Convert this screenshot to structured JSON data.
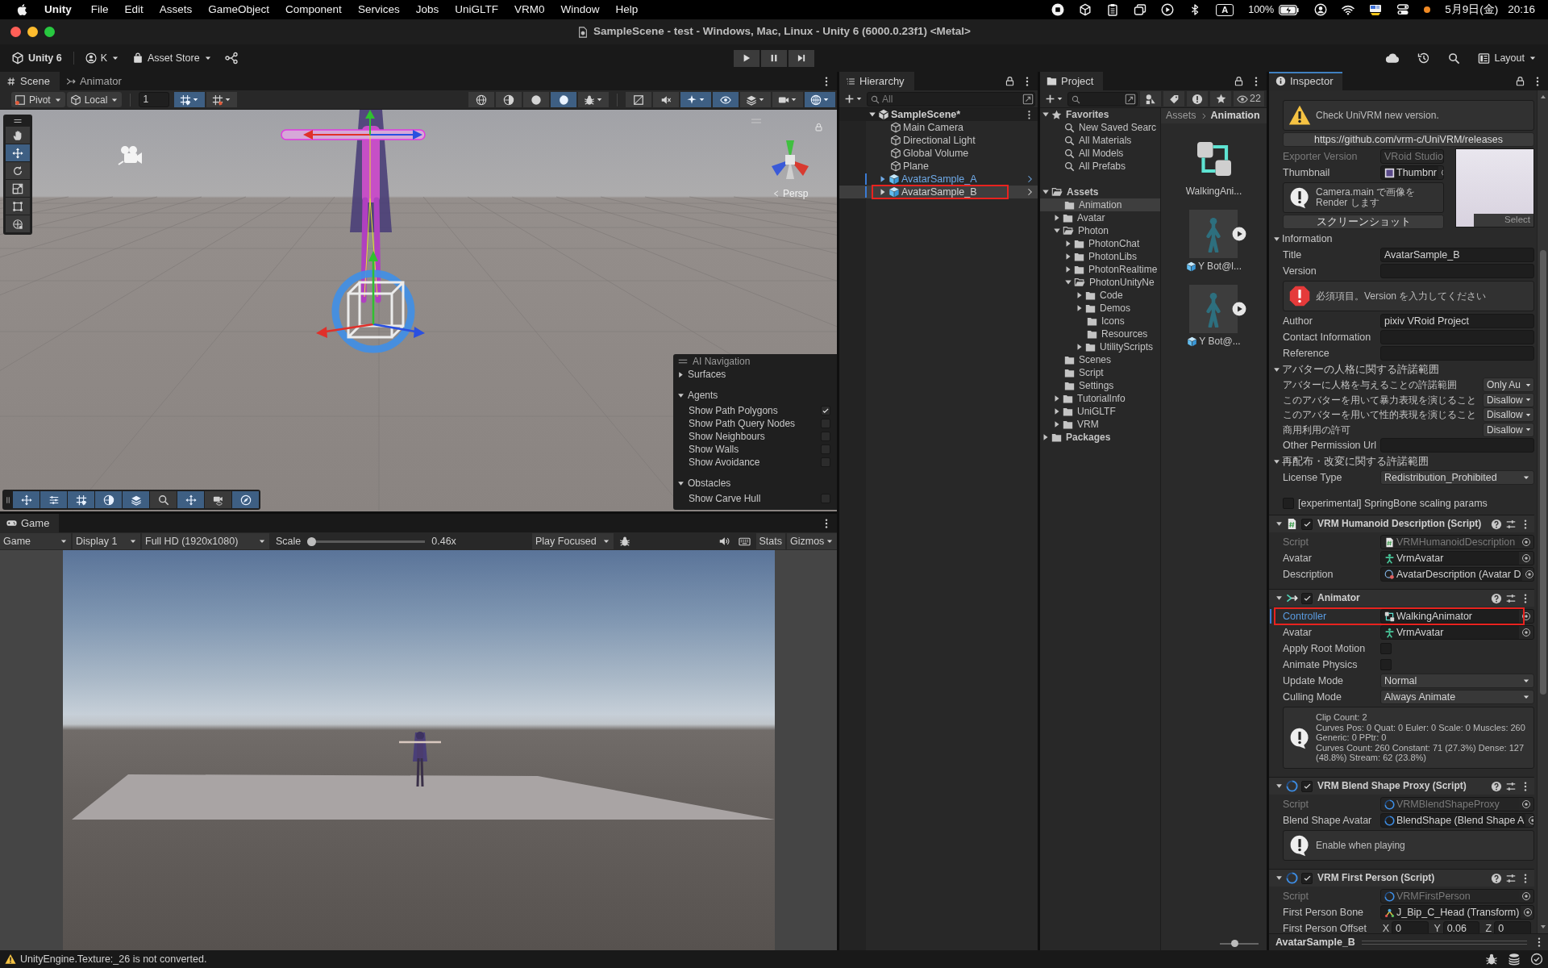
{
  "menu_bar": {
    "app": "Unity",
    "items": [
      "File",
      "Edit",
      "Assets",
      "GameObject",
      "Component",
      "Services",
      "Jobs",
      "UniGLTF",
      "VRM0",
      "Window",
      "Help"
    ],
    "input_source": "A",
    "battery": "100%",
    "date": "5月9日(金)",
    "time": "20:16"
  },
  "window": {
    "title": "SampleScene - test - Windows, Mac, Linux - Unity 6 (6000.0.23f1) <Metal>"
  },
  "toolbar": {
    "version": "Unity 6",
    "account": "K",
    "store": "Asset Store",
    "layout": "Layout"
  },
  "scene_panel": {
    "tabs": [
      {
        "label": "Scene",
        "kind": "scene",
        "selected": true
      },
      {
        "label": "Animator",
        "kind": "animator",
        "selected": false
      }
    ],
    "pivot": "Pivot",
    "space": "Local",
    "snap_increment": "1",
    "snap_buttons": [
      {
        "kind": "snap",
        "on": true
      },
      {
        "kind": "grid",
        "on": false
      }
    ],
    "view_buttons": [
      {
        "kind": "wireframe",
        "on": false
      },
      {
        "kind": "shadedwire",
        "on": false
      },
      {
        "kind": "shaded",
        "on": false
      },
      {
        "kind": "lit",
        "on": true
      },
      {
        "kind": "debug",
        "on": false
      },
      {
        "kind": "flat",
        "on": false
      },
      {
        "kind": "audio",
        "on": false
      },
      {
        "kind": "effects",
        "on": true
      },
      {
        "kind": "visibility",
        "on": true
      },
      {
        "kind": "layers",
        "on": false
      },
      {
        "kind": "camera",
        "on": false
      },
      {
        "kind": "gizmos",
        "on": true
      }
    ],
    "tools": [
      {
        "kind": "hand",
        "selected": false
      },
      {
        "kind": "move",
        "selected": true
      },
      {
        "kind": "rotate",
        "selected": false
      },
      {
        "kind": "scale",
        "selected": false
      },
      {
        "kind": "rect",
        "selected": false
      },
      {
        "kind": "transform",
        "selected": false
      }
    ],
    "camera_label": "Persp",
    "ai_navigation": {
      "title": "AI Navigation",
      "sections": [
        {
          "label": "Surfaces",
          "expanded": false
        },
        {
          "label": "Agents",
          "expanded": true,
          "options": [
            {
              "label": "Show Path Polygons",
              "checked": true
            },
            {
              "label": "Show Path Query Nodes",
              "checked": false
            },
            {
              "label": "Show Neighbours",
              "checked": false
            },
            {
              "label": "Show Walls",
              "checked": false
            },
            {
              "label": "Show Avoidance",
              "checked": false
            }
          ]
        },
        {
          "label": "Obstacles",
          "expanded": true,
          "options": [
            {
              "label": "Show Carve Hull",
              "checked": false
            }
          ]
        }
      ]
    },
    "overlay_buttons": [
      {
        "kind": "move",
        "on": true
      },
      {
        "kind": "settings",
        "on": true
      },
      {
        "kind": "grid",
        "on": true
      },
      {
        "kind": "lighting",
        "on": true
      },
      {
        "kind": "navmesh",
        "on": true
      },
      {
        "kind": "search",
        "on": false
      },
      {
        "kind": "pivot",
        "on": true
      },
      {
        "kind": "camera",
        "on": false
      },
      {
        "kind": "compass",
        "on": true
      }
    ]
  },
  "game_panel": {
    "tabs": [
      {
        "label": "Game",
        "kind": "game",
        "selected": true
      }
    ],
    "mode": "Game",
    "display": "Display 1",
    "resolution": "Full HD (1920x1080)",
    "scale_label": "Scale",
    "scale": {
      "level": 0
    },
    "scale_reading": "0.46x",
    "play_mode": "Play Focused",
    "stats": "Stats",
    "gizmos": "Gizmos"
  },
  "hierarchy": {
    "tab": "Hierarchy",
    "search_placeholder": "All",
    "items": [
      {
        "label": "SampleScene*",
        "kind": "scene",
        "expanded": true,
        "selected": false,
        "outlined": false,
        "children": [
          {
            "label": "Main Camera",
            "kind": "object",
            "selected": false,
            "outlined": false
          },
          {
            "label": "Directional Light",
            "kind": "object",
            "selected": false,
            "outlined": false
          },
          {
            "label": "Global Volume",
            "kind": "object",
            "selected": false,
            "outlined": false
          },
          {
            "label": "Plane",
            "kind": "object",
            "selected": false,
            "outlined": false
          },
          {
            "label": "AvatarSample_A",
            "kind": "prefab",
            "expanded": false,
            "selected": false,
            "outlined": false
          },
          {
            "label": "AvatarSample_B",
            "kind": "prefab",
            "expanded": false,
            "selected": true,
            "outlined": true
          }
        ]
      }
    ]
  },
  "project": {
    "tab": "Project",
    "hidden_count": "22",
    "favorites": [
      {
        "label": "Favorites",
        "kind": "favorites",
        "expanded": true,
        "selected": false,
        "children": [
          {
            "label": "New Saved Searc",
            "kind": "search",
            "selected": false
          },
          {
            "label": "All Materials",
            "kind": "search",
            "selected": false
          },
          {
            "label": "All Models",
            "kind": "search",
            "selected": false
          },
          {
            "label": "All Prefabs",
            "kind": "search",
            "selected": false
          }
        ]
      }
    ],
    "folders": [
      {
        "label": "Assets",
        "kind": "folder",
        "expanded": true,
        "selected": false,
        "children": [
          {
            "label": "Animation",
            "kind": "folder",
            "selected": true
          },
          {
            "label": "Avatar",
            "kind": "folder",
            "expanded": false,
            "selected": false
          },
          {
            "label": "Photon",
            "kind": "folder",
            "expanded": true,
            "selected": false,
            "children": [
              {
                "label": "PhotonChat",
                "kind": "folder",
                "expanded": false,
                "selected": false
              },
              {
                "label": "PhotonLibs",
                "kind": "folder",
                "expanded": false,
                "selected": false
              },
              {
                "label": "PhotonRealtime",
                "kind": "folder",
                "expanded": false,
                "selected": false
              },
              {
                "label": "PhotonUnityNe",
                "kind": "folder",
                "expanded": true,
                "selected": false,
                "children": [
                  {
                    "label": "Code",
                    "kind": "folder",
                    "expanded": false,
                    "selected": false
                  },
                  {
                    "label": "Demos",
                    "kind": "folder",
                    "expanded": false,
                    "selected": false
                  },
                  {
                    "label": "Icons",
                    "kind": "folder",
                    "selected": false
                  },
                  {
                    "label": "Resources",
                    "kind": "folder",
                    "selected": false
                  },
                  {
                    "label": "UtilityScripts",
                    "kind": "folder",
                    "expanded": false,
                    "selected": false
                  }
                ]
              }
            ]
          },
          {
            "label": "Scenes",
            "kind": "folder",
            "selected": false
          },
          {
            "label": "Script",
            "kind": "folder",
            "selected": false
          },
          {
            "label": "Settings",
            "kind": "folder",
            "selected": false
          },
          {
            "label": "TutorialInfo",
            "kind": "folder",
            "expanded": false,
            "selected": false
          },
          {
            "label": "UniGLTF",
            "kind": "folder",
            "expanded": false,
            "selected": false
          },
          {
            "label": "VRM",
            "kind": "folder",
            "expanded": false,
            "selected": false
          }
        ]
      },
      {
        "label": "Packages",
        "kind": "folder",
        "expanded": false,
        "selected": false
      }
    ],
    "breadcrumb": [
      "Assets",
      "Animation"
    ],
    "assets": [
      {
        "label": "WalkingAni...",
        "kind": "controller"
      },
      {
        "label": "Y Bot@l...",
        "kind": "model"
      },
      {
        "label": "Y Bot@...",
        "kind": "model"
      }
    ],
    "icon_size": {
      "level": 0.35
    }
  },
  "inspector": {
    "tab": "Inspector",
    "rows": [
      {
        "kind": "warning",
        "text": "Check UniVRM new version."
      },
      {
        "kind": "button",
        "label": "https://github.com/vrm-c/UniVRM/releases"
      },
      {
        "kind": "thumbnail",
        "select_label": "Select",
        "rows": [
          {
            "kind": "text",
            "label": "Exporter Version",
            "value": "VRoid Studio",
            "disabled": true
          },
          {
            "kind": "image",
            "label": "Thumbnail",
            "value": "Thumbnr",
            "disabled": false
          },
          {
            "kind": "info",
            "text": "Camera.main で画像を Render します"
          },
          {
            "kind": "button",
            "label": "スクリーンショット"
          }
        ]
      },
      {
        "kind": "foldout",
        "label": "Information",
        "expanded": true,
        "rows": [
          {
            "kind": "text",
            "label": "Title",
            "value": "AvatarSample_B",
            "disabled": false
          },
          {
            "kind": "text",
            "label": "Version",
            "disabled": false
          },
          {
            "kind": "error",
            "text": "必須項目。Version を入力してください"
          },
          {
            "kind": "text",
            "label": "Author",
            "value": "pixiv VRoid Project",
            "disabled": false
          },
          {
            "kind": "text",
            "label": "Contact Information",
            "disabled": false
          },
          {
            "kind": "text",
            "label": "Reference",
            "disabled": false
          }
        ]
      },
      {
        "kind": "foldout",
        "label": "アバターの人格に関する許諾範囲",
        "expanded": true,
        "rows": [
          {
            "kind": "select",
            "label": "アバターに人格を与えることの許諾範囲",
            "value": "Only Au"
          },
          {
            "kind": "select",
            "label": "このアバターを用いて暴力表現を演じること",
            "value": "Disallow"
          },
          {
            "kind": "select",
            "label": "このアバターを用いて性的表現を演じること",
            "value": "Disallow"
          },
          {
            "kind": "select",
            "label": "商用利用の許可",
            "value": "Disallow"
          },
          {
            "kind": "text",
            "label": "Other Permission Url",
            "disabled": false
          }
        ]
      },
      {
        "kind": "foldout",
        "label": "再配布・改変に関する許諾範囲",
        "expanded": true,
        "rows": [
          {
            "kind": "dropdown",
            "label": "License Type",
            "value": "Redistribution_Prohibited"
          }
        ]
      },
      {
        "kind": "checkbox",
        "label": "[experimental] SpringBone scaling params",
        "checked": false
      }
    ],
    "components": [
      {
        "title": "VRM Humanoid Description (Script)",
        "kind": "script",
        "enabled": true,
        "expanded": true,
        "rows": [
          {
            "kind": "script",
            "label": "Script",
            "value": "VRMHumanoidDescription",
            "disabled": true
          },
          {
            "kind": "avatar",
            "label": "Avatar",
            "value": "VrmAvatar",
            "disabled": false
          },
          {
            "kind": "description",
            "label": "Description",
            "value": "AvatarDescription (Avatar D",
            "disabled": false
          }
        ]
      },
      {
        "title": "Animator",
        "kind": "animator",
        "enabled": true,
        "expanded": true,
        "rows": [
          {
            "kind": "controller",
            "label": "Controller",
            "value": "WalkingAnimator",
            "disabled": false,
            "modified": true,
            "outlined": true
          },
          {
            "kind": "avatar",
            "label": "Avatar",
            "value": "VrmAvatar",
            "disabled": false
          },
          {
            "kind": "toggle",
            "label": "Apply Root Motion",
            "checked": false
          },
          {
            "kind": "toggle",
            "label": "Animate Physics",
            "checked": false
          },
          {
            "kind": "dropdown",
            "label": "Update Mode",
            "value": "Normal"
          },
          {
            "kind": "dropdown",
            "label": "Culling Mode",
            "value": "Always Animate"
          },
          {
            "kind": "stats",
            "text": "Clip Count: 2\nCurves Pos: 0 Quat: 0 Euler: 0 Scale: 0 Muscles: 260\nGeneric: 0 PPtr: 0\nCurves Count: 260 Constant: 71 (27.3%) Dense: 127 (48.8%) Stream: 62 (23.8%)"
          }
        ]
      },
      {
        "title": "VRM Blend Shape Proxy (Script)",
        "kind": "vrm",
        "enabled": true,
        "expanded": true,
        "rows": [
          {
            "kind": "vrmscript",
            "label": "Script",
            "value": "VRMBlendShapeProxy",
            "disabled": true
          },
          {
            "kind": "blendshape",
            "label": "Blend Shape Avatar",
            "value": "BlendShape (Blend Shape A",
            "disabled": false
          },
          {
            "kind": "info",
            "text": "Enable when playing"
          }
        ]
      },
      {
        "title": "VRM First Person (Script)",
        "kind": "vrm",
        "enabled": true,
        "expanded": true,
        "rows": [
          {
            "kind": "vrmscript",
            "label": "Script",
            "value": "VRMFirstPerson",
            "disabled": true
          },
          {
            "kind": "bone",
            "label": "First Person Bone",
            "value": "J_Bip_C_Head (Transform)",
            "disabled": false
          },
          {
            "kind": "vector",
            "label": "First Person Offset",
            "parts": [
              {
                "axis": "X",
                "value": "0"
              },
              {
                "axis": "Y",
                "value": "0.06"
              },
              {
                "axis": "Z",
                "value": "0"
              }
            ]
          }
        ]
      }
    ],
    "preview_title": "AvatarSample_B"
  },
  "status_bar": {
    "kind": "warning",
    "message": "UnityEngine.Texture:_26 is not converted."
  }
}
